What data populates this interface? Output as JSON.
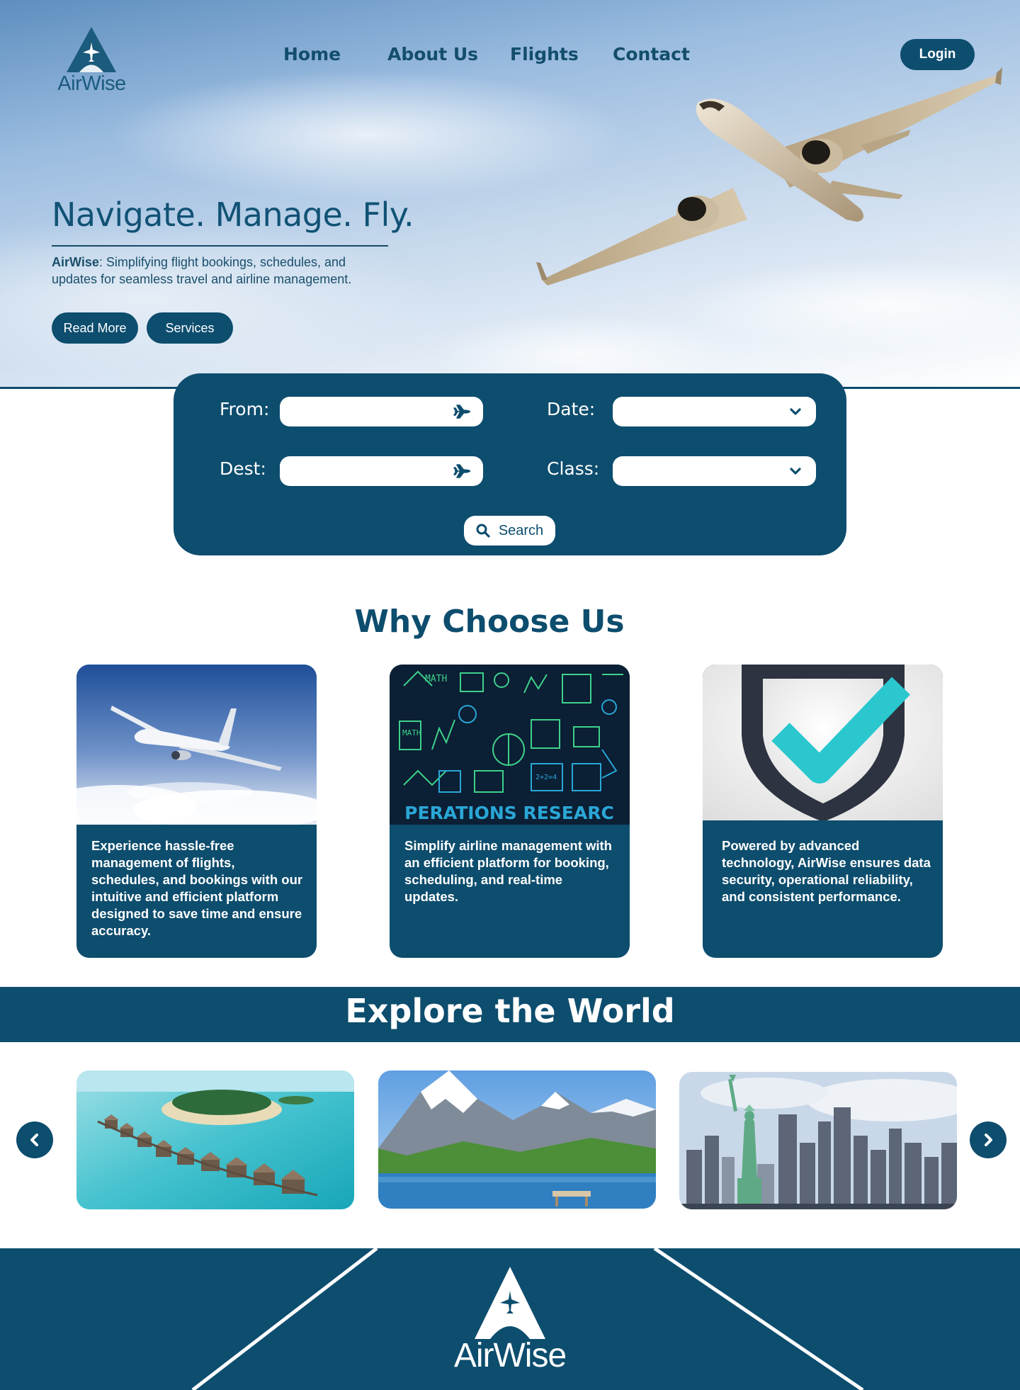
{
  "brand": {
    "name": "AirWise",
    "primary_color": "#0d4d6e"
  },
  "nav": {
    "items": [
      {
        "label": "Home"
      },
      {
        "label": "About Us"
      },
      {
        "label": "Flights"
      },
      {
        "label": "Contact"
      }
    ],
    "login_label": "Login"
  },
  "hero": {
    "title": "Navigate. Manage. Fly.",
    "desc_brand": "AirWise",
    "desc_text": ": Simplifying flight bookings, schedules, and updates for seamless travel and airline management.",
    "read_more_label": "Read More",
    "services_label": "Services"
  },
  "search": {
    "from_label": "From:",
    "dest_label": "Dest:",
    "date_label": "Date:",
    "class_label": "Class:",
    "button_label": "Search",
    "from_icon": "plane-icon",
    "dest_icon": "plane-icon",
    "date_icon": "chevron-down-icon",
    "class_icon": "chevron-down-icon",
    "button_icon": "search-icon"
  },
  "why": {
    "title": "Why Choose Us",
    "cards": [
      {
        "text": "Experience hassle-free management of flights, schedules, and bookings with our intuitive and efficient platform designed to save time and ensure accuracy."
      },
      {
        "text": "Simplify airline management with an efficient platform for booking, scheduling, and real-time updates.",
        "image_caption": "PERATIONS RESEARC",
        "image_words": [
          "MATH",
          "MATH",
          "2+2=4"
        ]
      },
      {
        "text": "Powered by advanced technology, AirWise ensures data security, operational reliability, and consistent performance."
      }
    ]
  },
  "explore": {
    "title": "Explore the World",
    "prev_icon": "chevron-left-icon",
    "next_icon": "chevron-right-icon"
  },
  "footer": {
    "logo_text": "AirWise"
  }
}
